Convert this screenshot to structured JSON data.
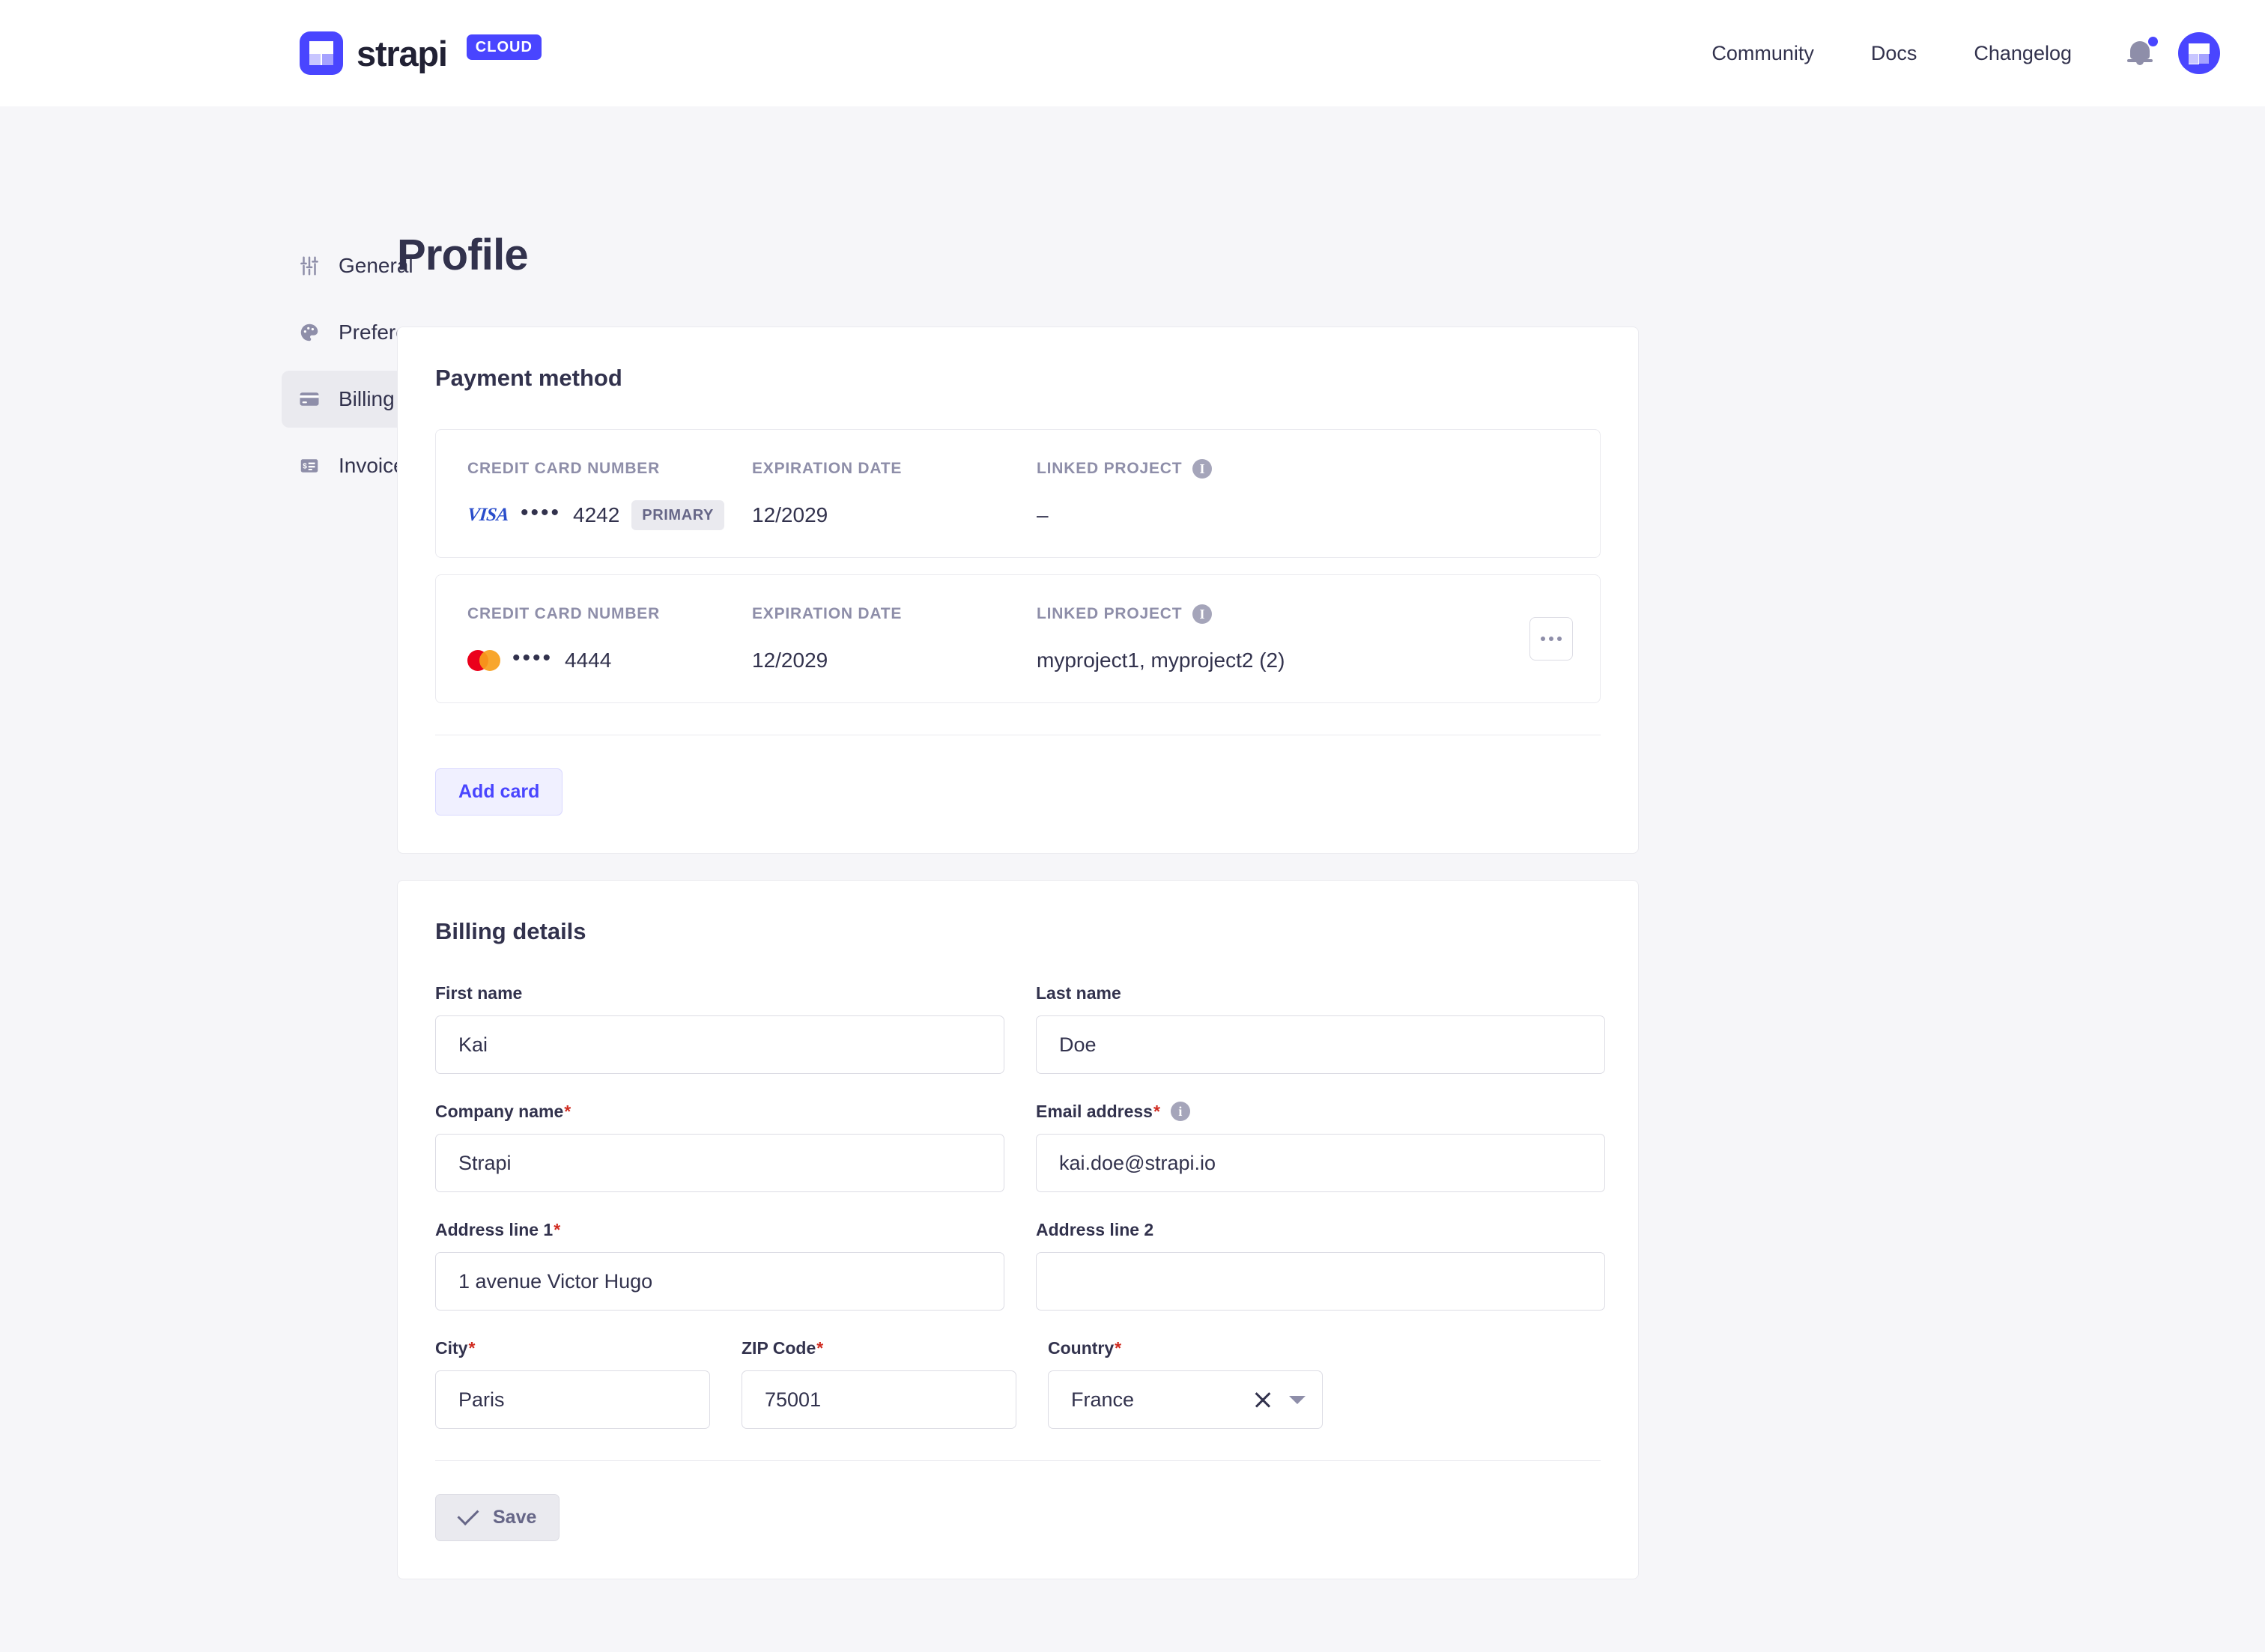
{
  "brand": {
    "name": "strapi",
    "badge": "CLOUD",
    "logo_icon": "strapi-logo-icon",
    "accent_color": "#4945ff"
  },
  "topnav": {
    "links": [
      {
        "label": "Community"
      },
      {
        "label": "Docs"
      },
      {
        "label": "Changelog"
      }
    ],
    "notifications_icon": "bell-icon",
    "avatar_icon": "user-avatar-icon"
  },
  "sidebar": {
    "items": [
      {
        "label": "General",
        "icon": "sliders-icon",
        "active": false
      },
      {
        "label": "Preferences",
        "icon": "palette-icon",
        "active": false
      },
      {
        "label": "Billing",
        "icon": "credit-card-icon",
        "active": true
      },
      {
        "label": "Invoices",
        "icon": "receipt-icon",
        "active": false
      }
    ]
  },
  "page": {
    "title": "Profile"
  },
  "payment_method": {
    "title": "Payment method",
    "columns": {
      "card_number": "CREDIT CARD NUMBER",
      "expiration": "EXPIRATION DATE",
      "linked_project": "LINKED PROJECT"
    },
    "info_tooltip_icon": "info-icon",
    "cards": [
      {
        "brand": "VISA",
        "brand_icon": "visa-logo-icon",
        "mask": "••••",
        "last4": "4242",
        "badge": "PRIMARY",
        "expiration": "12/2029",
        "linked_project": "–",
        "has_menu": false
      },
      {
        "brand": "Mastercard",
        "brand_icon": "mastercard-logo-icon",
        "mask": "••••",
        "last4": "4444",
        "badge": "",
        "expiration": "12/2029",
        "linked_project": "myproject1, myproject2 (2)",
        "has_menu": true,
        "menu_icon": "kebab-menu-icon"
      }
    ],
    "add_card_label": "Add card"
  },
  "billing_details": {
    "title": "Billing details",
    "fields": {
      "first_name": {
        "label": "First name",
        "required": false,
        "value": "Kai",
        "placeholder": ""
      },
      "last_name": {
        "label": "Last name",
        "required": false,
        "value": "Doe",
        "placeholder": ""
      },
      "company_name": {
        "label": "Company name",
        "required": true,
        "value": "Strapi",
        "placeholder": ""
      },
      "email_address": {
        "label": "Email address",
        "required": true,
        "value": "kai.doe@strapi.io",
        "placeholder": "",
        "has_info": true
      },
      "address_1": {
        "label": "Address line 1",
        "required": true,
        "value": "1 avenue Victor Hugo",
        "placeholder": ""
      },
      "address_2": {
        "label": "Address line 2",
        "required": false,
        "value": "",
        "placeholder": ""
      },
      "city": {
        "label": "City",
        "required": true,
        "value": "Paris",
        "placeholder": ""
      },
      "zip_code": {
        "label": "ZIP Code",
        "required": true,
        "value": "75001",
        "placeholder": ""
      },
      "country": {
        "label": "Country",
        "required": true,
        "value": "France",
        "placeholder": "",
        "clear_icon": "clear-icon",
        "caret_icon": "chevron-down-icon"
      }
    },
    "save_label": "Save",
    "save_icon": "check-icon"
  },
  "required_marker": "*"
}
